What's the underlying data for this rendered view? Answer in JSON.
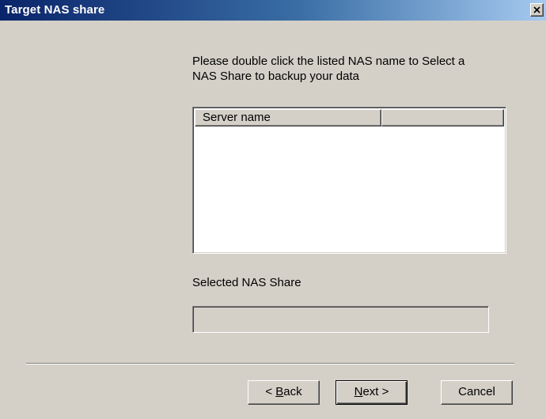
{
  "window": {
    "title": "Target NAS share",
    "close_icon": "close-icon"
  },
  "instructions": "Please double click the listed NAS name to Select a\nNAS Share to backup your data",
  "server_list": {
    "columns": [
      "Server name",
      ""
    ],
    "rows": []
  },
  "selected_share": {
    "label": "Selected NAS Share",
    "value": ""
  },
  "buttons": {
    "back": {
      "prefix": "< ",
      "mnemonic": "B",
      "rest": "ack"
    },
    "next": {
      "mnemonic": "N",
      "rest": "ext >"
    },
    "cancel": "Cancel"
  },
  "colors": {
    "titlebar_start": "#0a246a",
    "titlebar_end": "#a6caf0",
    "face": "#d4d0c8"
  }
}
